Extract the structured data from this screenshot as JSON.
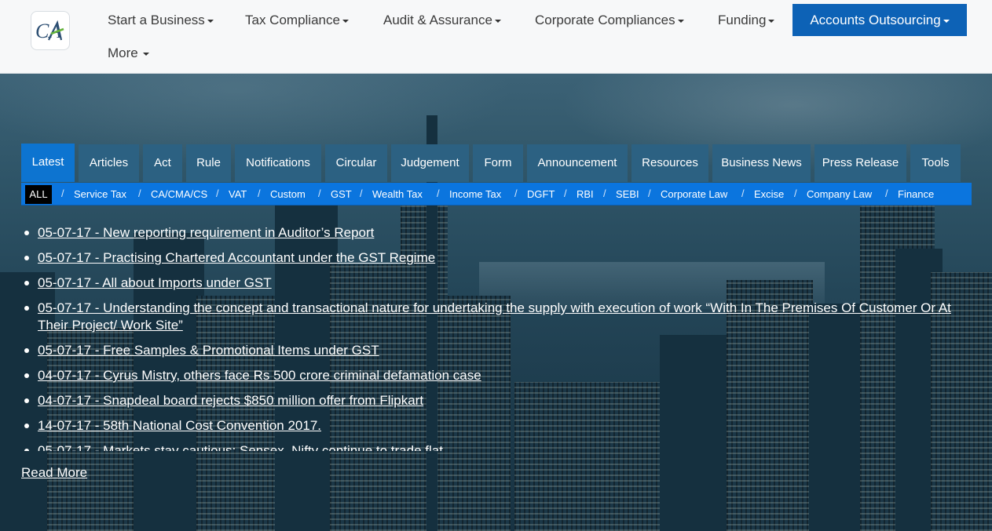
{
  "header": {
    "logo_text": "CA",
    "nav": [
      {
        "label": "Start a Business"
      },
      {
        "label": "Tax Compliance"
      },
      {
        "label": "Audit & Assurance"
      },
      {
        "label": "Corporate Compliances"
      },
      {
        "label": "Funding"
      },
      {
        "label": "More"
      }
    ],
    "active_nav": {
      "label": "Accounts Outsourcing"
    },
    "accent_color": "#0d62b6"
  },
  "tabs": [
    {
      "label": "Latest",
      "active": true
    },
    {
      "label": "Articles"
    },
    {
      "label": "Act"
    },
    {
      "label": "Rule"
    },
    {
      "label": "Notifications"
    },
    {
      "label": "Circular"
    },
    {
      "label": "Judgement"
    },
    {
      "label": "Form"
    },
    {
      "label": "Announcement"
    },
    {
      "label": "Resources"
    },
    {
      "label": "Business News"
    },
    {
      "label": "Press Release"
    },
    {
      "label": "Tools"
    }
  ],
  "subcategories": {
    "selected": "ALL",
    "items": [
      {
        "label": "Service Tax"
      },
      {
        "label": "CA/CMA/CS"
      },
      {
        "label": "VAT"
      },
      {
        "label": "Custom"
      },
      {
        "label": "GST"
      },
      {
        "label": "Wealth Tax"
      },
      {
        "label": "Income Tax"
      },
      {
        "label": "DGFT"
      },
      {
        "label": "RBI"
      },
      {
        "label": "SEBI"
      },
      {
        "label": "Corporate Law"
      },
      {
        "label": "Excise"
      },
      {
        "label": "Company Law"
      },
      {
        "label": "Finance"
      }
    ],
    "separator": "/"
  },
  "news": [
    {
      "text": "05-07-17 - New reporting requirement in Auditor’s Report"
    },
    {
      "text": "05-07-17 - Practising Chartered Accountant under the GST Regime"
    },
    {
      "text": "05-07-17 - All about Imports under GST"
    },
    {
      "text": "05-07-17 - Understanding the concept and transactional nature for undertaking the supply with execution of work “With In The Premises Of Customer Or At Their Project/ Work Site”"
    },
    {
      "text": "05-07-17 - Free Samples & Promotional Items under GST"
    },
    {
      "text": "04-07-17 - Cyrus Mistry, others face Rs 500 crore criminal defamation case"
    },
    {
      "text": "04-07-17 - Snapdeal board rejects $850 million offer from Flipkart"
    },
    {
      "text": "14-07-17 - 58th National Cost Convention 2017."
    },
    {
      "text": "05-07-17 - Markets stay cautious; Sensex, Nifty continue to trade flat"
    }
  ],
  "read_more": "Read More"
}
